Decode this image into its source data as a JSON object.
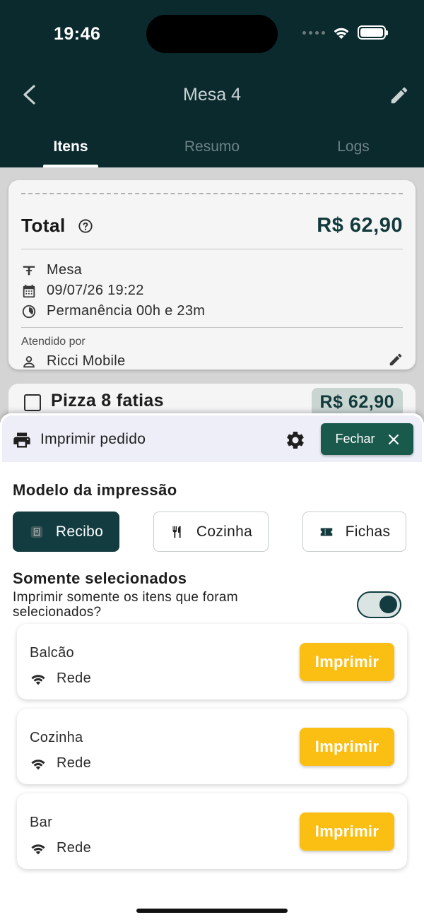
{
  "status_bar": {
    "time": "19:46"
  },
  "nav": {
    "title": "Mesa 4"
  },
  "tabs": [
    {
      "label": "Itens",
      "active": true
    },
    {
      "label": "Resumo",
      "active": false
    },
    {
      "label": "Logs",
      "active": false
    }
  ],
  "summary": {
    "total_label": "Total",
    "total_value": "R$ 62,90",
    "type": "Mesa",
    "datetime": "09/07/26 19:22",
    "stay": "Permanência 00h e 23m",
    "served_by_label": "Atendido por",
    "served_by": "Ricci Mobile"
  },
  "item": {
    "name": "Pizza 8 fatias",
    "price": "R$ 62,90"
  },
  "sheet": {
    "title": "Imprimir pedido",
    "close_label": "Fechar",
    "model_title": "Modelo da impressão",
    "models": [
      {
        "label": "Recibo",
        "icon": "receipt-icon",
        "selected": true
      },
      {
        "label": "Cozinha",
        "icon": "fork-knife-icon",
        "selected": false
      },
      {
        "label": "Fichas",
        "icon": "ticket-icon",
        "selected": false
      }
    ],
    "selected_only_title": "Somente selecionados",
    "selected_only_text": "Imprimir somente os itens que foram selecionados?",
    "selected_only_enabled": true,
    "printers": [
      {
        "name": "Balcão",
        "connection": "Rede",
        "action": "Imprimir"
      },
      {
        "name": "Cozinha",
        "connection": "Rede",
        "action": "Imprimir"
      },
      {
        "name": "Bar",
        "connection": "Rede",
        "action": "Imprimir"
      }
    ]
  },
  "colors": {
    "header": "#0b2a2e",
    "primary": "#123c40",
    "close_button": "#1a5a4d",
    "print_button": "#fbbe13"
  }
}
